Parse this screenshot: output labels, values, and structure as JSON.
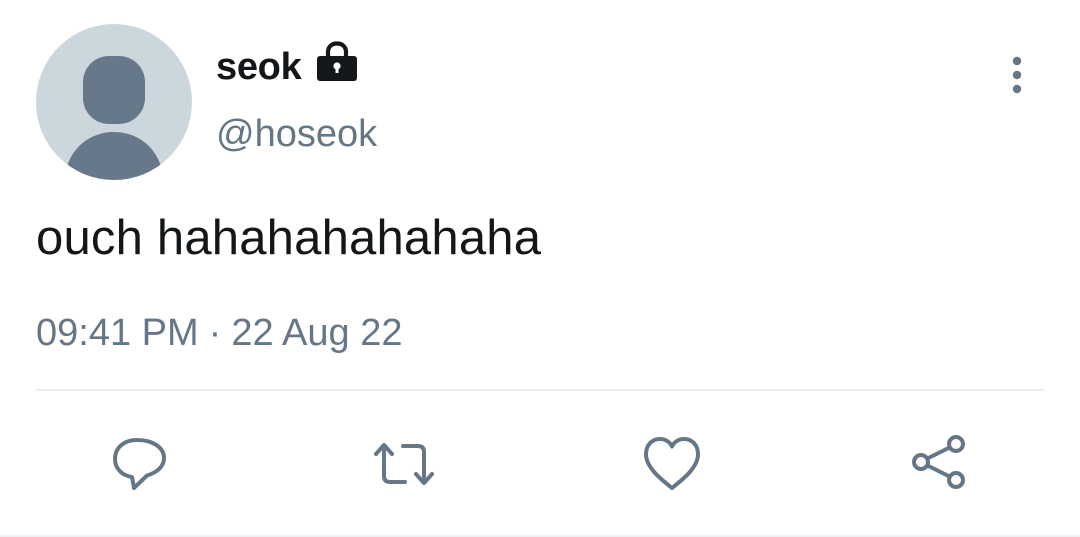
{
  "tweet": {
    "author": {
      "display_name": "seok",
      "handle": "@hoseok",
      "avatar": "default-avatar",
      "protected_icon": "lock-icon"
    },
    "more_icon": "vertical-dots-icon",
    "text": "ouch hahahahahahaha",
    "time": "09:41 PM",
    "separator": "·",
    "date": "22 Aug 22",
    "actions": [
      {
        "name": "reply",
        "icon": "speech-bubble-icon"
      },
      {
        "name": "retweet",
        "icon": "retweet-arrows-icon"
      },
      {
        "name": "like",
        "icon": "heart-icon"
      },
      {
        "name": "share",
        "icon": "share-icon"
      }
    ]
  },
  "colors": {
    "text_primary": "#14171a",
    "text_secondary": "#657786",
    "avatar_bg": "#ccd6dd",
    "avatar_figure": "#66788a",
    "divider": "#e6ecf0"
  }
}
